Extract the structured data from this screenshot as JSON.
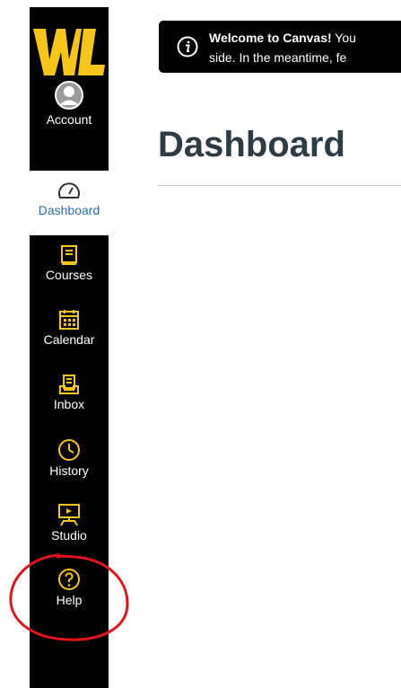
{
  "nav": {
    "logo_text": "WL",
    "items": [
      {
        "label": "Account",
        "icon": "account-avatar-icon"
      },
      {
        "label": "Dashboard",
        "icon": "dashboard-speedometer-icon"
      },
      {
        "label": "Courses",
        "icon": "courses-book-icon"
      },
      {
        "label": "Calendar",
        "icon": "calendar-icon"
      },
      {
        "label": "Inbox",
        "icon": "inbox-icon"
      },
      {
        "label": "History",
        "icon": "history-clock-icon"
      },
      {
        "label": "Studio",
        "icon": "studio-presentation-icon"
      },
      {
        "label": "Help",
        "icon": "help-question-icon"
      }
    ]
  },
  "alert": {
    "bold_text": "Welcome to Canvas!",
    "line1_rest": " You",
    "line2": "side. In the meantime, fe"
  },
  "main": {
    "title": "Dashboard"
  },
  "colors": {
    "nav_bg": "#000000",
    "accent_gold": "#f5c518",
    "active_blue": "#2d6fb6",
    "annotation_red": "#e0141e",
    "title_text": "#2d3b45"
  }
}
